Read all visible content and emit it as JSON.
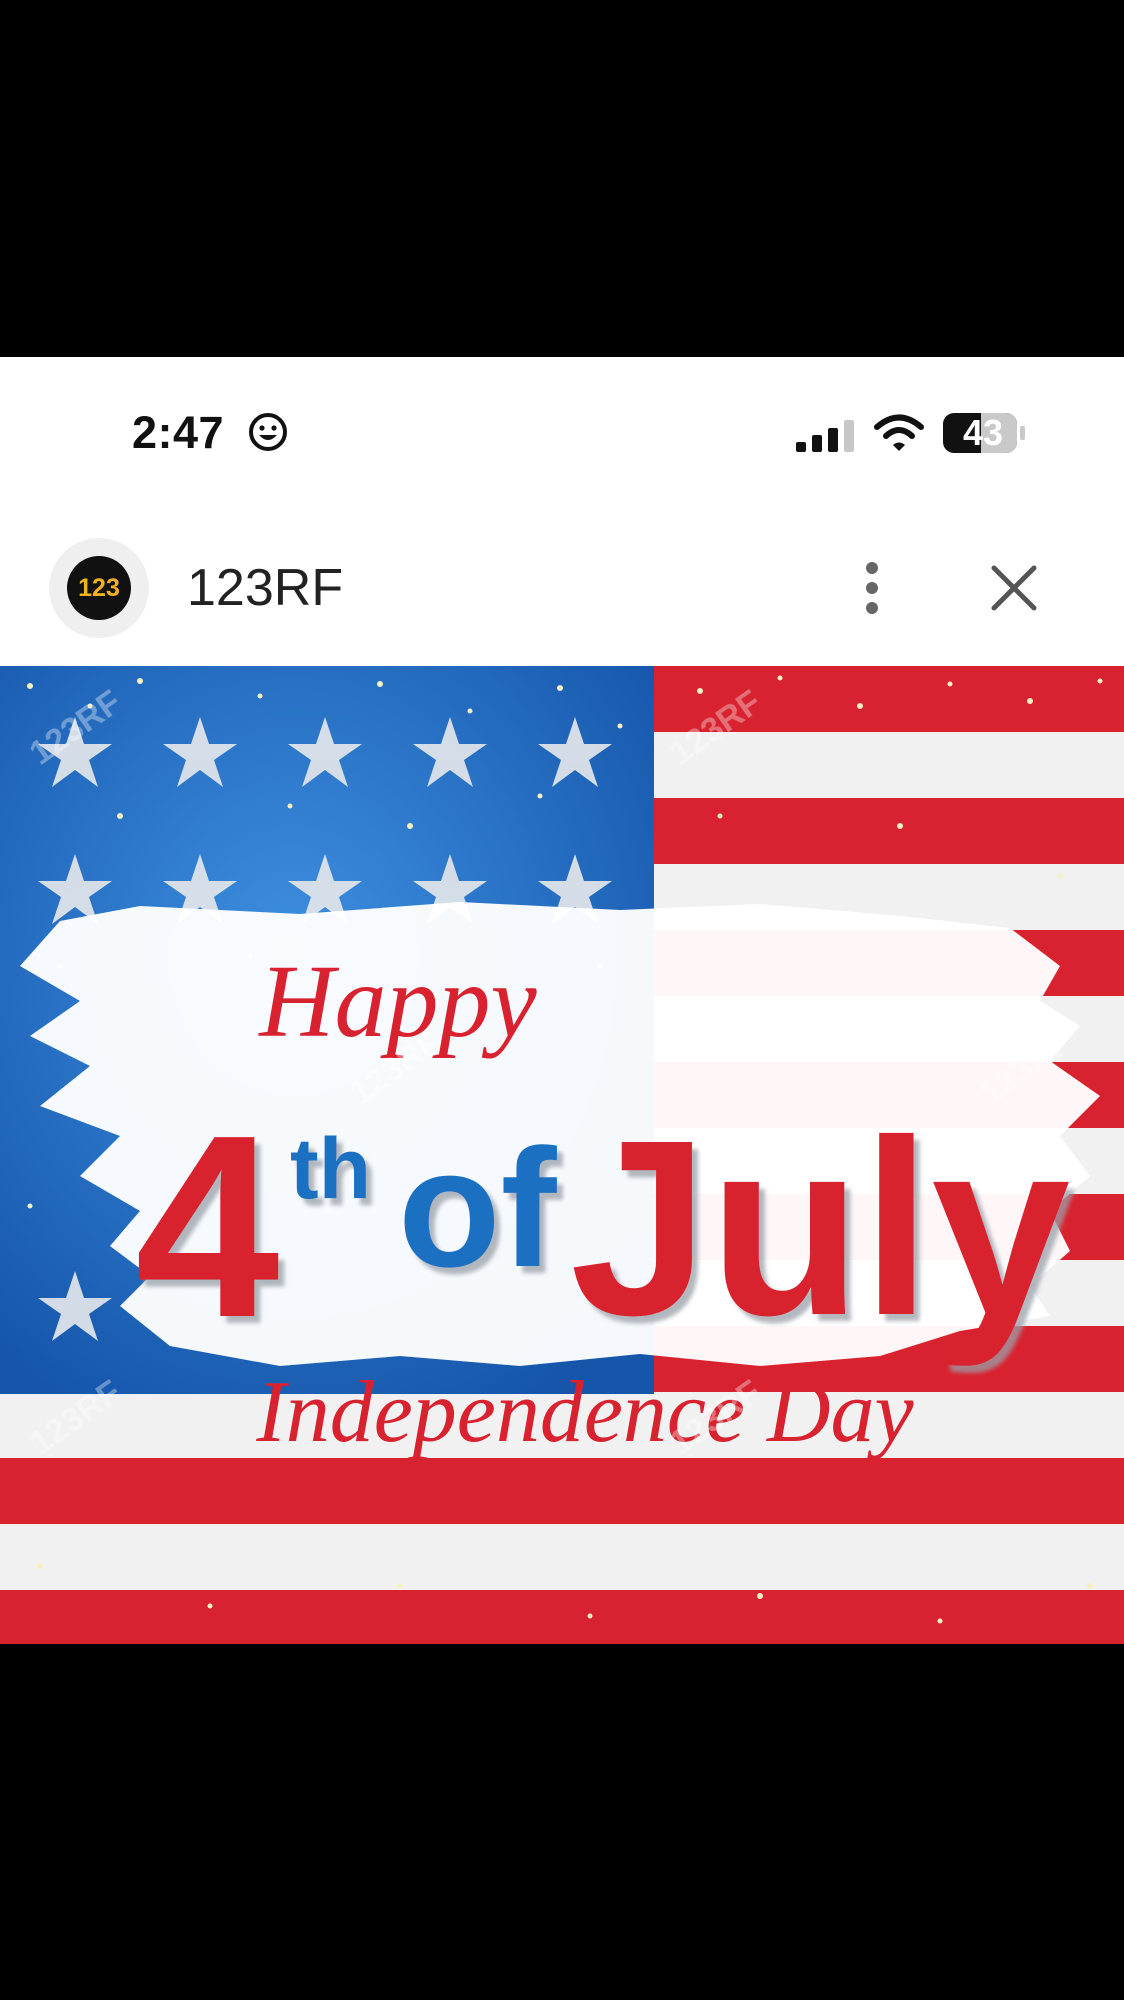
{
  "status_bar": {
    "time": "2:47",
    "battery_level": "43",
    "icons": [
      "smiley-face-icon",
      "signal-strength-icon",
      "wifi-icon",
      "battery-icon"
    ]
  },
  "header": {
    "logo_text": "123",
    "site_name": "123RF",
    "icons": [
      "more-options-icon",
      "close-icon"
    ]
  },
  "banner": {
    "line1": "Happy",
    "ordinal_number": "4",
    "ordinal_suffix": "th",
    "of_word": "of",
    "month": "July",
    "line3": "Independence Day",
    "watermark": "123RF"
  },
  "colors": {
    "flag_red": "#d8222f",
    "flag_blue": "#1f6fc2",
    "logo_yellow": "#f2b21d"
  }
}
